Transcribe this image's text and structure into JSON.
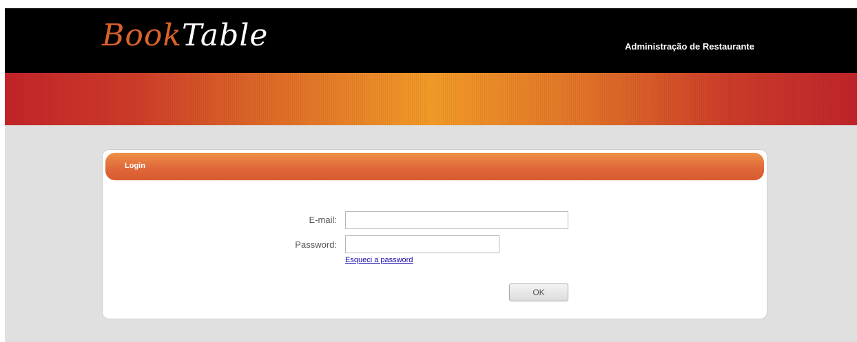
{
  "header": {
    "logo_part1": "Book",
    "logo_part2": "Table",
    "section_title": "Administração de Restaurante"
  },
  "colors": {
    "header_bg": "#000000",
    "logo_accent": "#d9622b",
    "banner_center": "#f29a28",
    "banner_edge": "#c42429",
    "login_header": "#e0683a"
  },
  "login": {
    "title": "Login",
    "email_label": "E-mail:",
    "email_value": "",
    "password_label": "Password:",
    "password_value": "",
    "forgot_link": "Esqueci a password",
    "ok_label": "OK"
  }
}
